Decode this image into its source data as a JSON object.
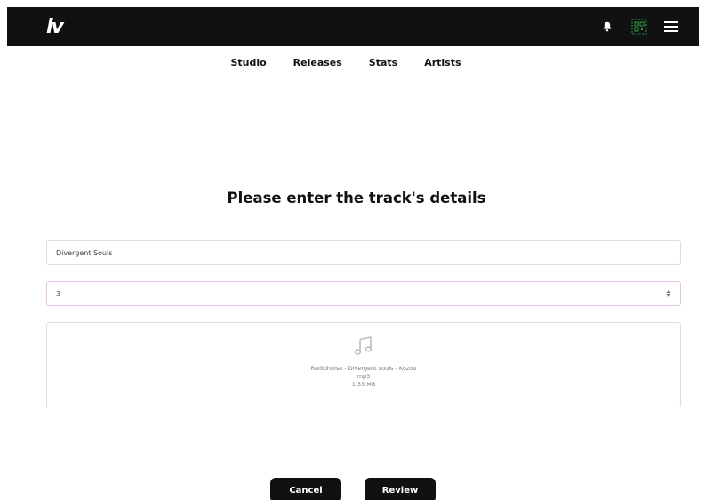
{
  "app": {
    "logo_text": "lv"
  },
  "topbar": {
    "icons": [
      "bell-icon",
      "qr-icon",
      "menu-icon"
    ],
    "qr_color": "#2ea043"
  },
  "nav": {
    "items": [
      "Studio",
      "Releases",
      "Stats",
      "Artists"
    ]
  },
  "form": {
    "title": "Please enter the track's details",
    "track_name_value": "Divergent Souls",
    "track_number_value": "3",
    "file": {
      "name": "Radiohoise - Divergent souls - Kozou",
      "ext": "mp3",
      "size": "1.33 MB"
    }
  },
  "actions": {
    "cancel_label": "Cancel",
    "review_label": "Review"
  }
}
